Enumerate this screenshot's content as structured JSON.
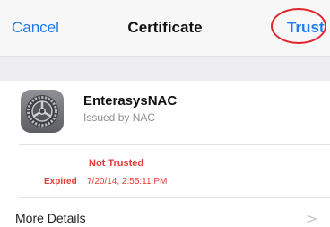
{
  "navbar": {
    "cancel_label": "Cancel",
    "title": "Certificate",
    "trust_label": "Trust"
  },
  "certificate": {
    "icon": "settings-gear-icon",
    "name": "EnterasysNAC",
    "issuer": "Issued by NAC",
    "status": "Not Trusted",
    "expired_label": "Expired",
    "expired_value": "7/20/14, 2:55:11 PM"
  },
  "more_details": {
    "label": "More Details",
    "chevron": ">"
  },
  "colors": {
    "accent": "#1e7cf2",
    "warning": "#e83a35",
    "highlight": "#e3262b"
  }
}
